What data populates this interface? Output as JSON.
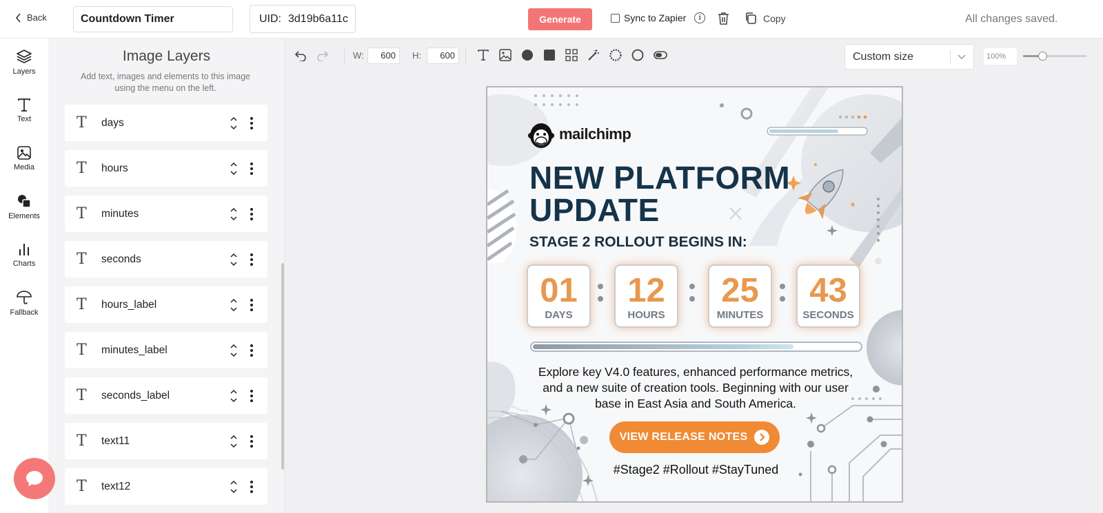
{
  "topbar": {
    "back_label": "Back",
    "title_value": "Countdown Timer",
    "uid_label": "UID:",
    "uid_value": "3d19b6a11c",
    "generate_label": "Generate",
    "sync_label": "Sync to Zapier",
    "copy_label": "Copy",
    "status": "All changes saved."
  },
  "rail": [
    {
      "label": "Layers",
      "icon": "layers-icon"
    },
    {
      "label": "Text",
      "icon": "text-icon"
    },
    {
      "label": "Media",
      "icon": "image-icon"
    },
    {
      "label": "Elements",
      "icon": "shapes-icon"
    },
    {
      "label": "Charts",
      "icon": "bar-chart-icon"
    },
    {
      "label": "Fallback",
      "icon": "umbrella-icon"
    }
  ],
  "panel": {
    "title": "Image Layers",
    "subtitle": "Add text, images and elements to this image using the menu on the left.",
    "layers": [
      {
        "name": "days"
      },
      {
        "name": "hours"
      },
      {
        "name": "minutes"
      },
      {
        "name": "seconds"
      },
      {
        "name": "hours_label"
      },
      {
        "name": "minutes_label"
      },
      {
        "name": "seconds_label"
      },
      {
        "name": "text11"
      },
      {
        "name": "text12"
      }
    ]
  },
  "toolbar": {
    "width_label": "W:",
    "width_value": "600",
    "height_label": "H:",
    "height_value": "600",
    "size_preset": "Custom size",
    "zoom": "100%",
    "zoom_level": 0.3
  },
  "design": {
    "brand": "mailchimp",
    "headline_line1": "NEW PLATFORM",
    "headline_line2": "UPDATE",
    "subhead": "STAGE 2 ROLLOUT BEGINS IN:",
    "countdown": [
      {
        "value": "01",
        "label": "DAYS"
      },
      {
        "value": "12",
        "label": "HOURS"
      },
      {
        "value": "25",
        "label": "MINUTES"
      },
      {
        "value": "43",
        "label": "SECONDS"
      }
    ],
    "progress": 0.8,
    "body_line1": "Explore key V4.0 features, enhanced performance metrics,",
    "body_line2": "and a new suite of creation tools. Beginning with our user",
    "body_line3": "base in East Asia and South America.",
    "cta_label": "VIEW RELEASE NOTES",
    "hashtags": "#Stage2 #Rollout #StayTuned",
    "colors": {
      "accent": "#f08a35",
      "headline": "#15344a",
      "generate": "#f47575",
      "digits": "#e8984f"
    }
  }
}
